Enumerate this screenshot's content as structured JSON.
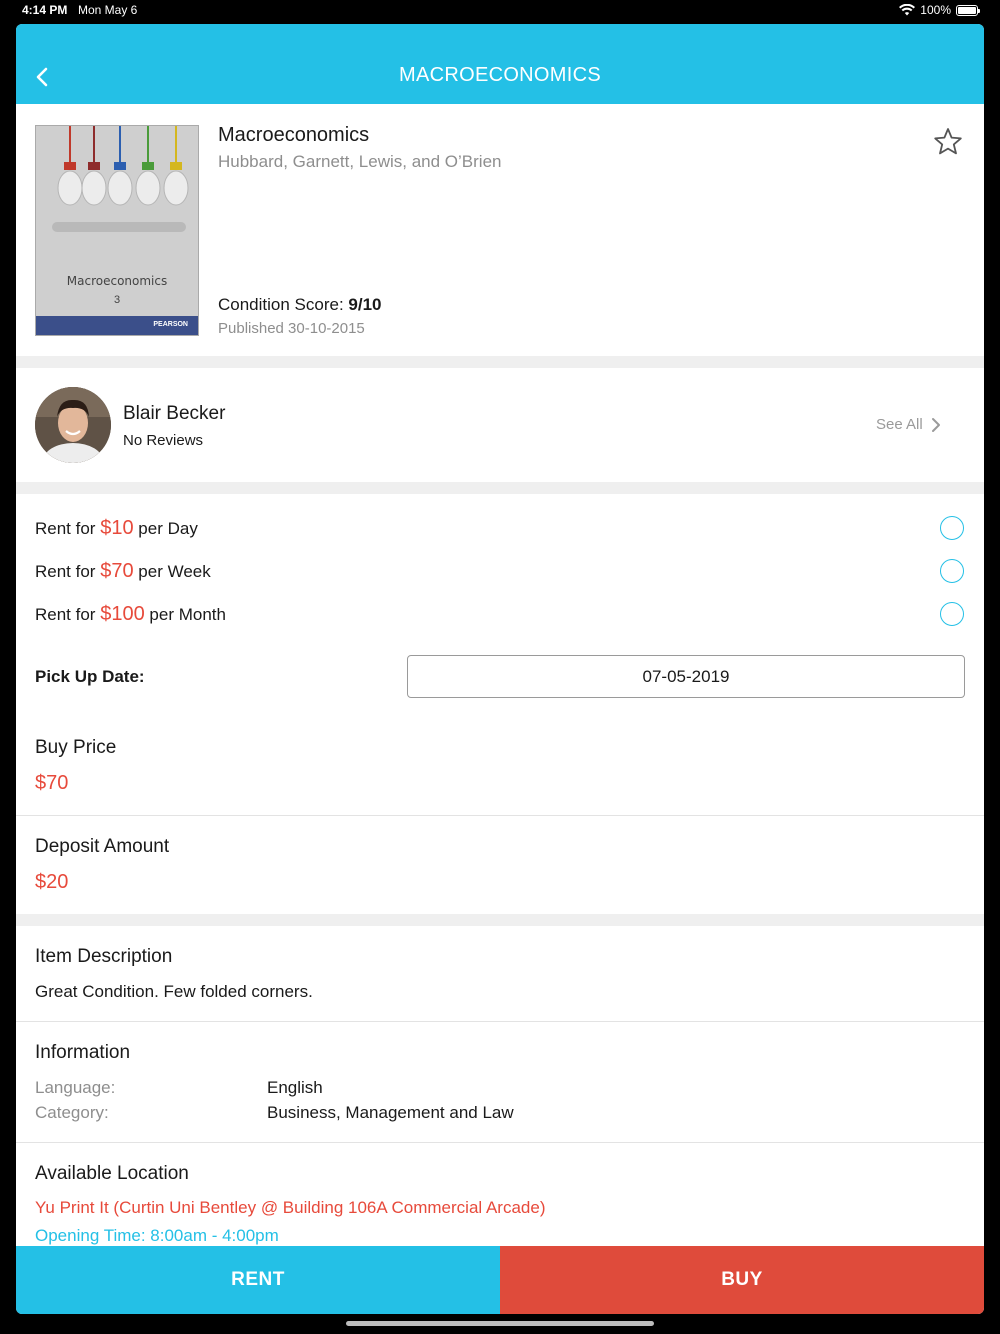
{
  "status_bar": {
    "time": "4:14 PM",
    "date": "Mon May 6",
    "battery": "100%"
  },
  "nav": {
    "title": "MACROECONOMICS",
    "back_icon": "chevron-left-icon"
  },
  "book": {
    "title": "Macroeconomics",
    "authors": "Hubbard, Garnett, Lewis, and O’Brien",
    "condition_label": "Condition Score:",
    "condition_value": "9/10",
    "published": "Published 30-10-2015",
    "cover_title": "Macroeconomics",
    "cover_edition": "3",
    "cover_publisher": "PEARSON",
    "favorite_icon": "star-outline-icon"
  },
  "seller": {
    "name": "Blair Becker",
    "reviews": "No Reviews",
    "see_all": "See All"
  },
  "rent_options": [
    {
      "prefix": "Rent for ",
      "price": "$10",
      "suffix": " per Day"
    },
    {
      "prefix": "Rent for ",
      "price": "$70",
      "suffix": " per Week"
    },
    {
      "prefix": "Rent for ",
      "price": "$100",
      "suffix": " per Month"
    }
  ],
  "pickup": {
    "label": "Pick Up Date:",
    "value": "07-05-2019"
  },
  "buy": {
    "label": "Buy Price",
    "value": "$70"
  },
  "deposit": {
    "label": "Deposit Amount",
    "value": "$20"
  },
  "description": {
    "label": "Item Description",
    "text": "Great Condition. Few folded corners."
  },
  "information": {
    "label": "Information",
    "language_key": "Language:",
    "language_value": "English",
    "category_key": "Category:",
    "category_value": "Business, Management and Law"
  },
  "location": {
    "label": "Available Location",
    "name": "Yu Print It (Curtin Uni Bentley @ Building 106A Commercial Arcade)",
    "opening": "Opening Time: 8:00am - 4:00pm"
  },
  "actions": {
    "rent": "RENT",
    "buy": "BUY"
  },
  "colors": {
    "accent": "#24c0e6",
    "price": "#e74a3b",
    "buy_button": "#df4b3b"
  }
}
